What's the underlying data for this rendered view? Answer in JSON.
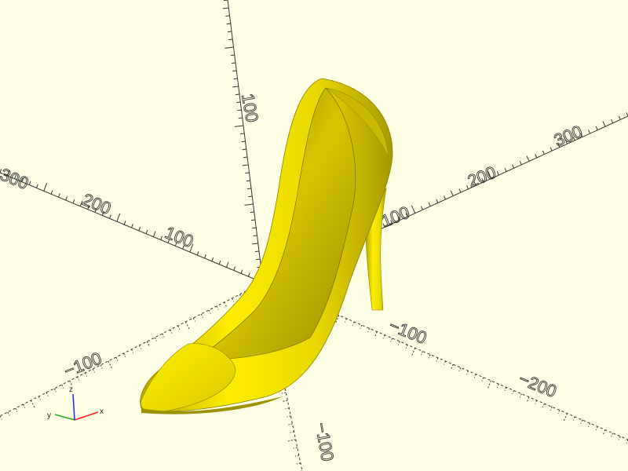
{
  "viewport": {
    "background": "#ffffe5",
    "model_color": "#ffee00",
    "model_shadow": "#8c7f00",
    "axis_color": "#333333"
  },
  "scale_labels": {
    "y_pos_100": "100",
    "x_neg_100": "100",
    "x_neg_200": "200",
    "x_neg_300": "300",
    "x_pos_100": "100",
    "x_pos_200": "200",
    "x_pos_300": "300",
    "y_neg_100": "−100",
    "y_neg_200": "−200",
    "y_neg_100_lower": "−100",
    "z_pos_100": "100",
    "z_neg_100": "−100",
    "x_neg_100_lower": "−100"
  },
  "axes_indicator": {
    "x": "x",
    "y": "y",
    "z": "z",
    "x_color": "#ff2020",
    "y_color": "#20b020",
    "z_color": "#2020ff"
  }
}
